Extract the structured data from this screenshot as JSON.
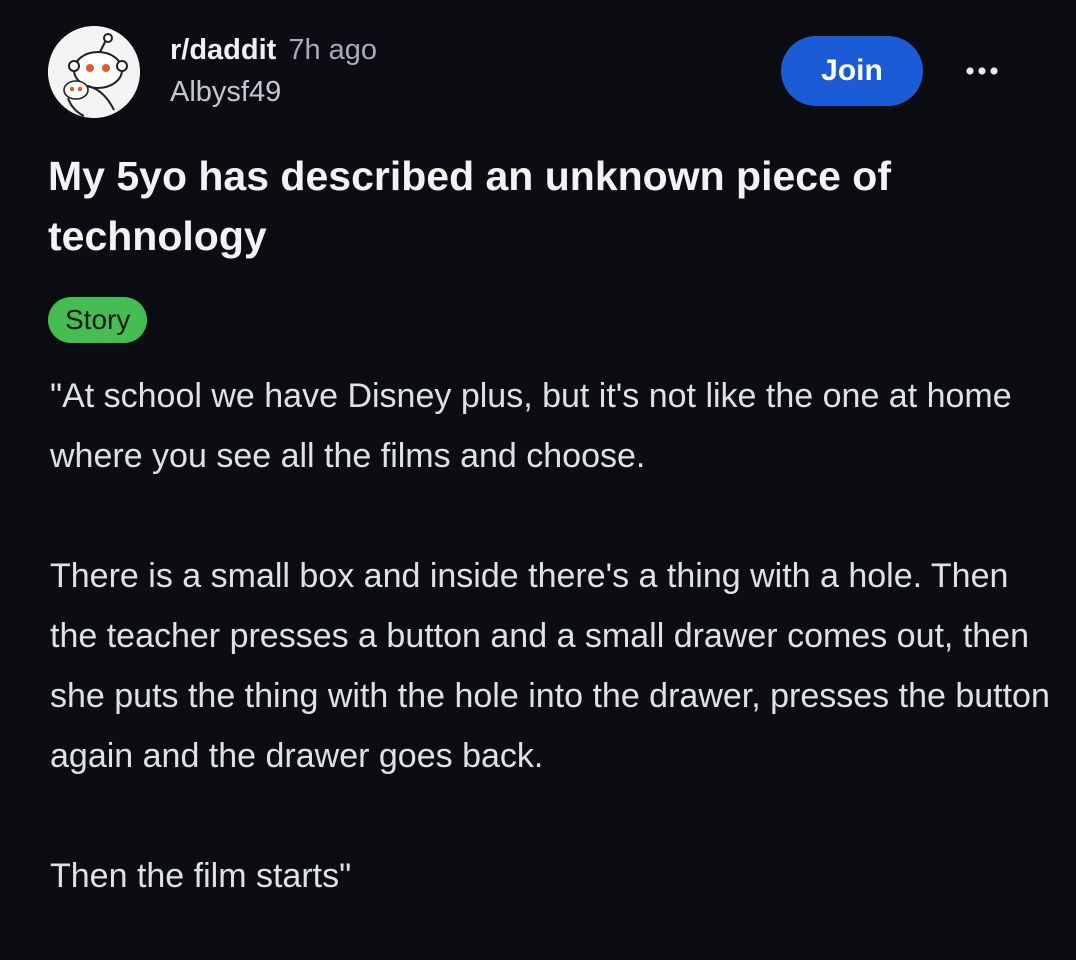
{
  "post": {
    "subreddit": "r/daddit",
    "time": "7h ago",
    "author": "Albysf49",
    "join_label": "Join",
    "more_label": "...",
    "title": "My 5yo has described an unknown piece of technology",
    "flair": "Story",
    "paragraphs": [
      "\"At school we have Disney plus, but it's not like the one at home where you see all the films and choose.",
      "There is a small box and inside there's a thing with a hole. Then the teacher presses a button and a small drawer comes out, then she puts the thing with the hole into the drawer, presses the button again and the drawer goes back.",
      "Then the film starts\""
    ]
  },
  "colors": {
    "background": "#0b0d12",
    "join_button": "#1b5cd6",
    "flair_background": "#46bd52"
  },
  "icons": {
    "avatar": "subreddit-avatar-icon",
    "more": "more-options-icon"
  }
}
